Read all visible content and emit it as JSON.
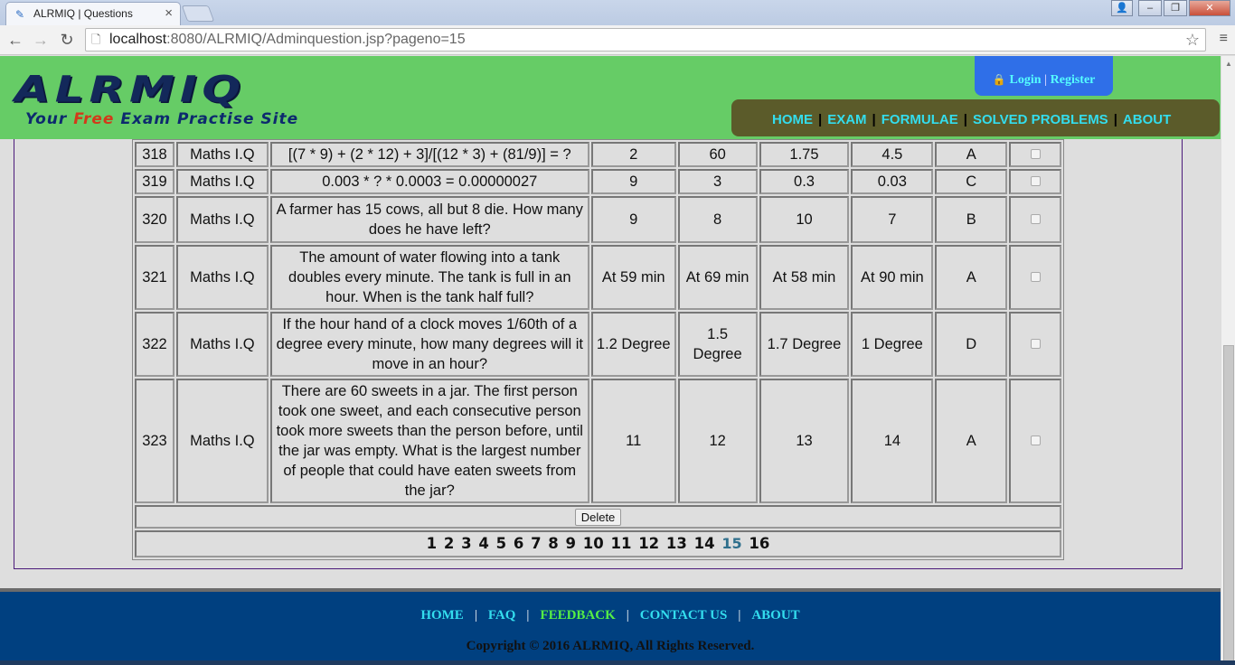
{
  "browser": {
    "tab_title": "ALRMIQ | Questions",
    "url_host": "localhost",
    "url_path": ":8080/ALRMIQ/Adminquestion.jsp?pageno=15"
  },
  "header": {
    "logo": "ALRMIQ",
    "tagline_before": "Your ",
    "tagline_free": "Free",
    "tagline_after": " Exam Practise Site",
    "login": "Login",
    "register": "Register",
    "nav": [
      "HOME",
      "EXAM",
      "FORMULAE",
      "SOLVED PROBLEMS",
      "ABOUT"
    ]
  },
  "table": {
    "rows": [
      {
        "id": "318",
        "category": "Maths I.Q",
        "question": "[(7 * 9) + (2 * 12) + 3]/[(12 * 3) + (81/9)] = ?",
        "a": "2",
        "b": "60",
        "c": "1.75",
        "d": "4.5",
        "answer": "A"
      },
      {
        "id": "319",
        "category": "Maths I.Q",
        "question": "0.003 * ? * 0.0003 = 0.00000027",
        "a": "9",
        "b": "3",
        "c": "0.3",
        "d": "0.03",
        "answer": "C"
      },
      {
        "id": "320",
        "category": "Maths I.Q",
        "question": "A farmer has 15 cows, all but 8 die. How many does he have left?",
        "a": "9",
        "b": "8",
        "c": "10",
        "d": "7",
        "answer": "B"
      },
      {
        "id": "321",
        "category": "Maths I.Q",
        "question": "The amount of water flowing into a tank doubles every minute. The tank is full in an hour. When is the tank half full?",
        "a": "At 59 min",
        "b": "At 69 min",
        "c": "At 58 min",
        "d": "At 90 min",
        "answer": "A"
      },
      {
        "id": "322",
        "category": "Maths I.Q",
        "question": "If the hour hand of a clock moves 1/60th of a degree every minute, how many degrees will it move in an hour?",
        "a": "1.2 Degree",
        "b": "1.5 Degree",
        "c": "1.7 Degree",
        "d": "1 Degree",
        "answer": "D"
      },
      {
        "id": "323",
        "category": "Maths I.Q",
        "question": "There are 60 sweets in a jar. The first person took one sweet, and each consecutive person took more sweets than the person before, until the jar was empty. What is the largest number of people that could have eaten sweets from the jar?",
        "a": "11",
        "b": "12",
        "c": "13",
        "d": "14",
        "answer": "A"
      }
    ],
    "delete_label": "Delete",
    "pages": [
      "1",
      "2",
      "3",
      "4",
      "5",
      "6",
      "7",
      "8",
      "9",
      "10",
      "11",
      "12",
      "13",
      "14",
      "15",
      "16"
    ],
    "current_page": "15"
  },
  "footer": {
    "links": [
      "HOME",
      "FAQ",
      "FEEDBACK",
      "CONTACT US",
      "ABOUT"
    ],
    "copyright": "Copyright © 2016 ALRMIQ, All Rights Reserved."
  }
}
